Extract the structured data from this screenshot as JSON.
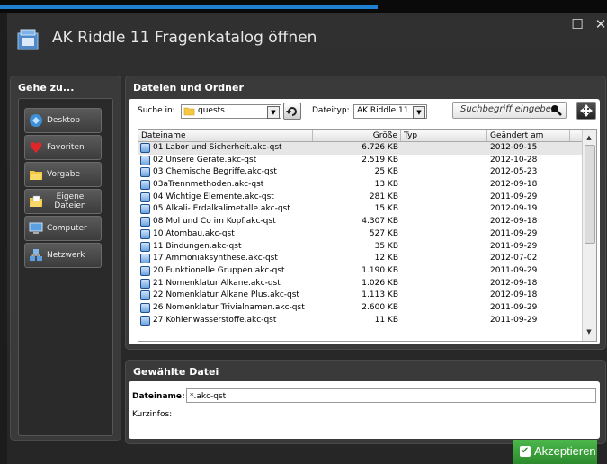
{
  "window": {
    "title": "AK Riddle 11 Fragenkatalog öffnen",
    "maximize_glyph": "☐",
    "close_glyph": "✕"
  },
  "nav": {
    "title": "Gehe zu...",
    "items": [
      {
        "label": "Desktop",
        "icon": "desktop-icon"
      },
      {
        "label": "Favoriten",
        "icon": "heart-icon"
      },
      {
        "label": "Vorgabe",
        "icon": "folder-icon"
      },
      {
        "label": "Eigene Dateien",
        "icon": "documents-folder-icon"
      },
      {
        "label": "Computer",
        "icon": "computer-icon"
      },
      {
        "label": "Netzwerk",
        "icon": "network-icon"
      }
    ]
  },
  "files": {
    "title": "Dateien und Ordner",
    "search_in_label": "Suche in:",
    "search_in_value": "quests",
    "filetype_label": "Dateityp:",
    "filetype_value": "AK Riddle 11",
    "search_placeholder": "Suchbegriff eingeben",
    "columns": [
      "Dateiname",
      "Größe",
      "Typ",
      "Geändert am"
    ],
    "rows": [
      {
        "name": "01 Labor und Sicherheit.akc-qst",
        "size": "6.726 KB",
        "type": "",
        "date": "2012-09-15"
      },
      {
        "name": "02 Unsere Geräte.akc-qst",
        "size": "2.519 KB",
        "type": "",
        "date": "2012-10-28"
      },
      {
        "name": "03 Chemische Begriffe.akc-qst",
        "size": "25 KB",
        "type": "",
        "date": "2012-05-23"
      },
      {
        "name": "03aTrennmethoden.akc-qst",
        "size": "13 KB",
        "type": "",
        "date": "2012-09-18"
      },
      {
        "name": "04 Wichtige Elemente.akc-qst",
        "size": "281 KB",
        "type": "",
        "date": "2011-09-29"
      },
      {
        "name": "05 Alkali- Erdalkalimetalle.akc-qst",
        "size": "15 KB",
        "type": "",
        "date": "2012-09-19"
      },
      {
        "name": "08 Mol und Co im Kopf.akc-qst",
        "size": "4.307 KB",
        "type": "",
        "date": "2012-09-18"
      },
      {
        "name": "10 Atombau.akc-qst",
        "size": "527 KB",
        "type": "",
        "date": "2011-09-29"
      },
      {
        "name": "11 Bindungen.akc-qst",
        "size": "35 KB",
        "type": "",
        "date": "2011-09-29"
      },
      {
        "name": "17 Ammoniaksynthese.akc-qst",
        "size": "12 KB",
        "type": "",
        "date": "2012-07-02"
      },
      {
        "name": "20 Funktionelle Gruppen.akc-qst",
        "size": "1.190 KB",
        "type": "",
        "date": "2011-09-29"
      },
      {
        "name": "21 Nomenklatur Alkane.akc-qst",
        "size": "1.026 KB",
        "type": "",
        "date": "2012-09-18"
      },
      {
        "name": "22 Nomenklatur Alkane Plus.akc-qst",
        "size": "1.113 KB",
        "type": "",
        "date": "2012-09-18"
      },
      {
        "name": "26 Nomenklatur Trivialnamen.akc-qst",
        "size": "2.600 KB",
        "type": "",
        "date": "2011-09-29"
      },
      {
        "name": "27 Kohlenwasserstoffe.akc-qst",
        "size": "11 KB",
        "type": "",
        "date": "2011-09-29"
      }
    ]
  },
  "selected": {
    "title": "Gewählte Datei",
    "filename_label": "Dateiname:",
    "filename_value": "*.akc-qst",
    "info_label": "Kurzinfos:"
  },
  "accept_label": "Akzeptieren",
  "colors": {
    "accent": "#2c8a2c",
    "window": "#2b2b2b",
    "panel": "#3a3a3a"
  }
}
